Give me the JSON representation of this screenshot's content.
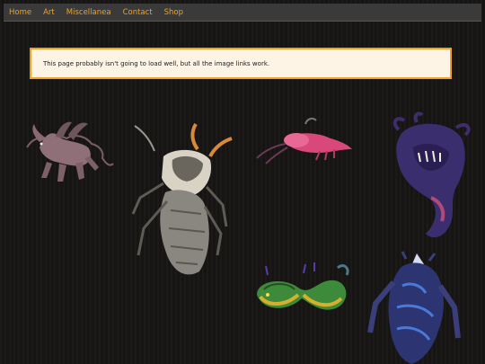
{
  "nav": {
    "items": [
      "Home",
      "Art",
      "Miscellanea",
      "Contact",
      "Shop"
    ],
    "link_color": "#f0a21e",
    "bar_color": "#3a3a3a"
  },
  "notice": {
    "text": "This page probably isn't going to load well, but all the image links work.",
    "border_color": "#f0a21e",
    "background": "#fdf4e6"
  },
  "gallery": {
    "items": [
      {
        "name": "sphinx-cat-creature"
      },
      {
        "name": "stag-beetle-creature"
      },
      {
        "name": "pink-shrimp-creature"
      },
      {
        "name": "purple-horned-serpent"
      },
      {
        "name": "green-coiled-serpent"
      },
      {
        "name": "blue-armored-creature"
      }
    ]
  }
}
